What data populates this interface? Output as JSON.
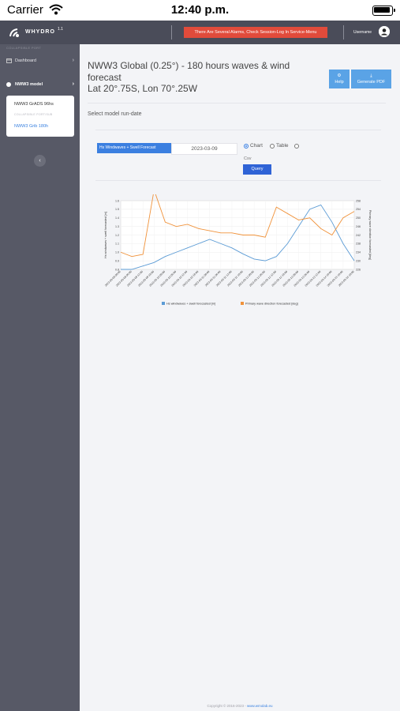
{
  "status_bar": {
    "carrier": "Carrier",
    "time": "12:40 p.m."
  },
  "header": {
    "logo_text": "WHYDRO",
    "version": "1.1",
    "alert_text": "There Are Several Alarms, Check Session-Log In Service-Menu",
    "username": "Username"
  },
  "sidebar": {
    "section_label": "COLLAPSIBLE PORT",
    "dashboard_label": "Dashboard",
    "model_label": "NWW3 model",
    "sub_items": [
      "NWW3 GrADS 96hs",
      "COLLAPSIBLE PORT/SUB",
      "NWW3 Grib 180h"
    ],
    "collapse_icon": "chevron-left-icon"
  },
  "main": {
    "title": "NWW3 Global (0.25°) - 180 hours waves & wind forecast",
    "subtitle": "Lat 20°.75S, Lon 70°.25W",
    "help_label": "Help",
    "pdf_label": "Generate PDF",
    "select_rundate_label": "Select model run-date",
    "variable_value": "Hs Windwaves + Swell Forecast",
    "date_value": "2023-03-09",
    "radio_chart": "Chart",
    "radio_table": "Table",
    "radio_csv": "Csv",
    "query_label": "Query",
    "footer_text": "Copyright © 2016-2023 - ",
    "footer_link": "www.wmolab.eu"
  },
  "colors": {
    "accent": "#3b7fe0",
    "alert": "#e14b3b",
    "sidebar": "#575966",
    "topbar": "#4a4c59",
    "series1": "#5b9bd5",
    "series2": "#f0923a"
  },
  "chart_data": {
    "type": "line",
    "x": [
      "2023-03-09 00:00",
      "2023-03-09 06:00",
      "2023-03-09 12:00",
      "2023-03-09 18:00",
      "2023-03-10 00:00",
      "2023-03-10 06:00",
      "2023-03-10 12:00",
      "2023-03-10 18:00",
      "2023-03-11 00:00",
      "2023-03-11 06:00",
      "2023-03-11 12:00",
      "2023-03-11 18:00",
      "2023-03-12 00:00",
      "2023-03-12 06:00",
      "2023-03-12 12:00",
      "2023-03-12 18:00",
      "2023-03-13 00:00",
      "2023-03-13 06:00",
      "2023-03-13 12:00",
      "2023-03-14 00:00",
      "2023-03-15 00:00",
      "2023-03-16 00:00"
    ],
    "x_tick_labels": [
      "2023-03-09 00:00",
      "2023-03-09 06:00",
      "2023-03-09 12:00",
      "2023-03-09 18:00",
      "2023-03-10 00:00",
      "2023-03-10 06:00",
      "2023-03-10 12:00",
      "2023-03-10 18:00",
      "2023-03-11 00:00",
      "2023-03-11 06:00",
      "2023-03-11 12:00",
      "2023-03-11 18:00",
      "2023-03-12 00:00",
      "2023-03-12 06:00",
      "2023-03-12 12:00",
      "2023-03-12 18:00",
      "2023-03-13 00:00",
      "2023-03-13 06:00",
      "2023-03-13 12:00",
      "2023-03-14 18:00",
      "2023-03-15 18:00",
      "2023-03-16 18:00"
    ],
    "series": [
      {
        "name": "Hs windwaves + swell forecasted [m]",
        "axis": "left",
        "values": [
          0.8,
          0.8,
          0.84,
          0.88,
          0.95,
          1.0,
          1.05,
          1.1,
          1.15,
          1.1,
          1.05,
          0.98,
          0.92,
          0.9,
          0.95,
          1.1,
          1.3,
          1.5,
          1.55,
          1.35,
          1.1,
          0.9
        ]
      },
      {
        "name": "Primary wave direction forecasted [deg]",
        "axis": "right",
        "values": [
          234,
          232,
          233,
          263,
          248,
          246,
          247,
          245,
          244,
          243,
          243,
          242,
          242,
          241,
          255,
          252,
          249,
          250,
          245,
          242,
          250,
          253
        ]
      }
    ],
    "ylabel_left": "Hs windwaves + swell forecasted [m]",
    "ylabel_right": "Primary wave direction forecasted [deg]",
    "yticks_left": [
      "0.8",
      "0.9",
      "1.0",
      "1.1",
      "1.2",
      "1.3",
      "1.4",
      "1.5",
      "1.6"
    ],
    "yticks_right": [
      "226",
      "230",
      "234",
      "238",
      "242",
      "246",
      "250",
      "254",
      "258"
    ],
    "ylim_left": [
      0.8,
      1.6
    ],
    "ylim_right": [
      226,
      258
    ],
    "grid": true,
    "legend": "bottom"
  }
}
